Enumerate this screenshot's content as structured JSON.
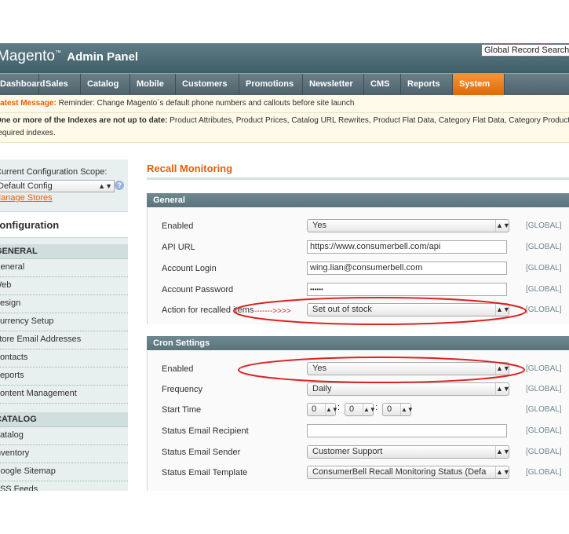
{
  "header": {
    "logo_main": "Magento",
    "logo_tm": "™",
    "logo_sub": "Admin Panel",
    "global_search": "Global Record Search"
  },
  "nav": {
    "items": [
      "Dashboard",
      "Sales",
      "Catalog",
      "Mobile",
      "Customers",
      "Promotions",
      "Newsletter",
      "CMS",
      "Reports",
      "System"
    ],
    "active": "System"
  },
  "messages": {
    "latest_label": "Latest Message:",
    "latest_text": "Reminder: Change Magento`s default phone numbers and callouts before site launch",
    "index_bold": "One or more of the Indexes are not up to date:",
    "index_text": "Product Attributes, Product Prices, Catalog URL Rewrites, Product Flat Data, Category Flat Data, Category Products, Ca",
    "index_line2": "required indexes."
  },
  "sidebar": {
    "scope_label": "Current Configuration Scope:",
    "scope_value": "Default Config",
    "manage_stores": "Manage Stores",
    "config_title": "Configuration",
    "general_head": "GENERAL",
    "general_items": [
      "General",
      "Web",
      "Design",
      "Currency Setup",
      "Store Email Addresses",
      "Contacts",
      "Reports",
      "Content Management"
    ],
    "catalog_head": "CATALOG",
    "catalog_items": [
      "Catalog",
      "Inventory",
      "Google Sitemap",
      "RSS Feeds"
    ]
  },
  "main": {
    "page_title": "Recall Monitoring",
    "general": {
      "title": "General",
      "enabled_label": "Enabled",
      "enabled_value": "Yes",
      "api_url_label": "API URL",
      "api_url_value": "https://www.consumerbell.com/api",
      "login_label": "Account Login",
      "login_value": "wing.lian@consumerbell.com",
      "password_label": "Account Password",
      "password_value": "••••••",
      "action_label": "Action for recalled items",
      "action_value": "Set out of stock"
    },
    "cron": {
      "title": "Cron Settings",
      "enabled_label": "Enabled",
      "enabled_value": "Yes",
      "frequency_label": "Frequency",
      "frequency_value": "Daily",
      "start_label": "Start Time",
      "start_h": "0",
      "start_m": "0",
      "start_s": "0",
      "recipient_label": "Status Email Recipient",
      "recipient_value": "",
      "sender_label": "Status Email Sender",
      "sender_value": "Customer Support",
      "template_label": "Status Email Template",
      "template_value": "ConsumerBell Recall Monitoring Status (Defa"
    },
    "scope_tag": "[GLOBAL]",
    "annotation_arrow": "------->>>>"
  },
  "colors": {
    "accent": "#eb5e00",
    "annotation": "#dd2222",
    "header": "#4b6871"
  }
}
